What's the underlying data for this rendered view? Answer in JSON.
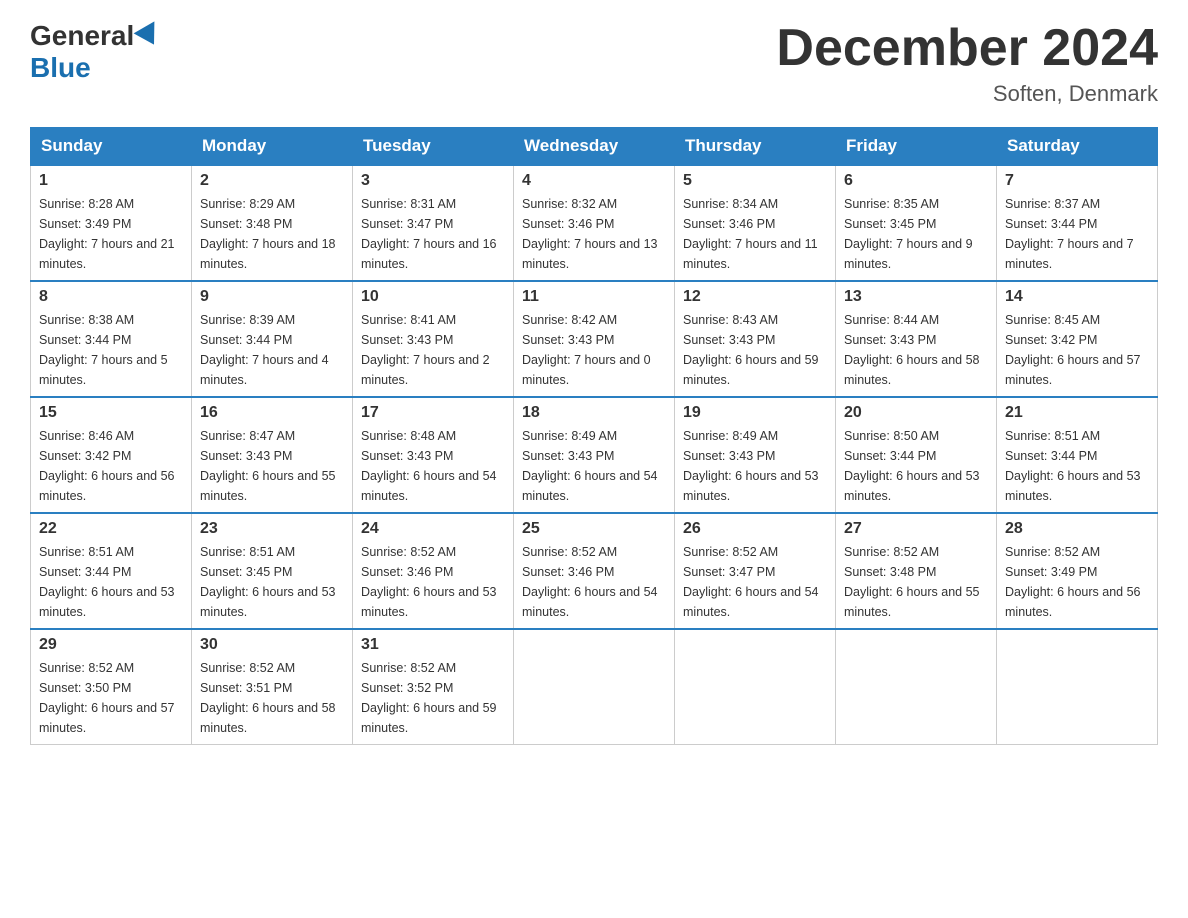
{
  "header": {
    "logo_general": "General",
    "logo_blue": "Blue",
    "month_title": "December 2024",
    "location": "Soften, Denmark"
  },
  "days_header": [
    "Sunday",
    "Monday",
    "Tuesday",
    "Wednesday",
    "Thursday",
    "Friday",
    "Saturday"
  ],
  "weeks": [
    [
      {
        "day": "1",
        "sunrise": "8:28 AM",
        "sunset": "3:49 PM",
        "daylight": "7 hours and 21 minutes."
      },
      {
        "day": "2",
        "sunrise": "8:29 AM",
        "sunset": "3:48 PM",
        "daylight": "7 hours and 18 minutes."
      },
      {
        "day": "3",
        "sunrise": "8:31 AM",
        "sunset": "3:47 PM",
        "daylight": "7 hours and 16 minutes."
      },
      {
        "day": "4",
        "sunrise": "8:32 AM",
        "sunset": "3:46 PM",
        "daylight": "7 hours and 13 minutes."
      },
      {
        "day": "5",
        "sunrise": "8:34 AM",
        "sunset": "3:46 PM",
        "daylight": "7 hours and 11 minutes."
      },
      {
        "day": "6",
        "sunrise": "8:35 AM",
        "sunset": "3:45 PM",
        "daylight": "7 hours and 9 minutes."
      },
      {
        "day": "7",
        "sunrise": "8:37 AM",
        "sunset": "3:44 PM",
        "daylight": "7 hours and 7 minutes."
      }
    ],
    [
      {
        "day": "8",
        "sunrise": "8:38 AM",
        "sunset": "3:44 PM",
        "daylight": "7 hours and 5 minutes."
      },
      {
        "day": "9",
        "sunrise": "8:39 AM",
        "sunset": "3:44 PM",
        "daylight": "7 hours and 4 minutes."
      },
      {
        "day": "10",
        "sunrise": "8:41 AM",
        "sunset": "3:43 PM",
        "daylight": "7 hours and 2 minutes."
      },
      {
        "day": "11",
        "sunrise": "8:42 AM",
        "sunset": "3:43 PM",
        "daylight": "7 hours and 0 minutes."
      },
      {
        "day": "12",
        "sunrise": "8:43 AM",
        "sunset": "3:43 PM",
        "daylight": "6 hours and 59 minutes."
      },
      {
        "day": "13",
        "sunrise": "8:44 AM",
        "sunset": "3:43 PM",
        "daylight": "6 hours and 58 minutes."
      },
      {
        "day": "14",
        "sunrise": "8:45 AM",
        "sunset": "3:42 PM",
        "daylight": "6 hours and 57 minutes."
      }
    ],
    [
      {
        "day": "15",
        "sunrise": "8:46 AM",
        "sunset": "3:42 PM",
        "daylight": "6 hours and 56 minutes."
      },
      {
        "day": "16",
        "sunrise": "8:47 AM",
        "sunset": "3:43 PM",
        "daylight": "6 hours and 55 minutes."
      },
      {
        "day": "17",
        "sunrise": "8:48 AM",
        "sunset": "3:43 PM",
        "daylight": "6 hours and 54 minutes."
      },
      {
        "day": "18",
        "sunrise": "8:49 AM",
        "sunset": "3:43 PM",
        "daylight": "6 hours and 54 minutes."
      },
      {
        "day": "19",
        "sunrise": "8:49 AM",
        "sunset": "3:43 PM",
        "daylight": "6 hours and 53 minutes."
      },
      {
        "day": "20",
        "sunrise": "8:50 AM",
        "sunset": "3:44 PM",
        "daylight": "6 hours and 53 minutes."
      },
      {
        "day": "21",
        "sunrise": "8:51 AM",
        "sunset": "3:44 PM",
        "daylight": "6 hours and 53 minutes."
      }
    ],
    [
      {
        "day": "22",
        "sunrise": "8:51 AM",
        "sunset": "3:44 PM",
        "daylight": "6 hours and 53 minutes."
      },
      {
        "day": "23",
        "sunrise": "8:51 AM",
        "sunset": "3:45 PM",
        "daylight": "6 hours and 53 minutes."
      },
      {
        "day": "24",
        "sunrise": "8:52 AM",
        "sunset": "3:46 PM",
        "daylight": "6 hours and 53 minutes."
      },
      {
        "day": "25",
        "sunrise": "8:52 AM",
        "sunset": "3:46 PM",
        "daylight": "6 hours and 54 minutes."
      },
      {
        "day": "26",
        "sunrise": "8:52 AM",
        "sunset": "3:47 PM",
        "daylight": "6 hours and 54 minutes."
      },
      {
        "day": "27",
        "sunrise": "8:52 AM",
        "sunset": "3:48 PM",
        "daylight": "6 hours and 55 minutes."
      },
      {
        "day": "28",
        "sunrise": "8:52 AM",
        "sunset": "3:49 PM",
        "daylight": "6 hours and 56 minutes."
      }
    ],
    [
      {
        "day": "29",
        "sunrise": "8:52 AM",
        "sunset": "3:50 PM",
        "daylight": "6 hours and 57 minutes."
      },
      {
        "day": "30",
        "sunrise": "8:52 AM",
        "sunset": "3:51 PM",
        "daylight": "6 hours and 58 minutes."
      },
      {
        "day": "31",
        "sunrise": "8:52 AM",
        "sunset": "3:52 PM",
        "daylight": "6 hours and 59 minutes."
      },
      null,
      null,
      null,
      null
    ]
  ]
}
